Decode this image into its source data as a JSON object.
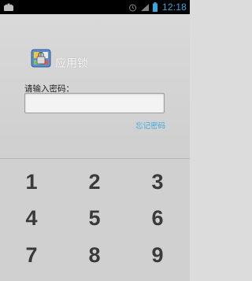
{
  "status_bar": {
    "time": "12:18",
    "icons": [
      "android-debug-icon",
      "alarm-clock-icon",
      "signal-icon",
      "battery-icon"
    ]
  },
  "app": {
    "title": "应用锁",
    "icon": "app-lock-icon"
  },
  "form": {
    "prompt": "请输入密码：",
    "password_value": "",
    "password_placeholder": "",
    "forgot_link": "忘记密码"
  },
  "keypad": {
    "keys": [
      "1",
      "2",
      "3",
      "4",
      "5",
      "6",
      "7",
      "8",
      "9"
    ]
  },
  "colors": {
    "accent": "#3fa9e0",
    "background": "#dcdcdc",
    "status_bar": "#000000",
    "key_text": "#3a3a3a"
  }
}
